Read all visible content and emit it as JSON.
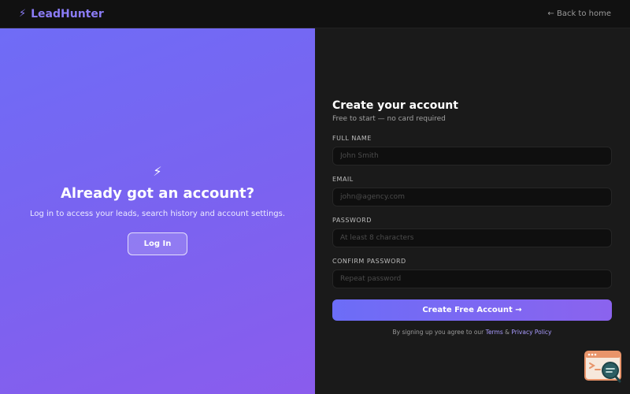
{
  "header": {
    "brand_icon": "⚡",
    "brand_name": "LeadHunter",
    "back_link": "← Back to home"
  },
  "left": {
    "icon": "⚡",
    "title": "Already got an account?",
    "text": "Log in to access your leads, search history and account settings.",
    "login_label": "Log In"
  },
  "form": {
    "title": "Create your account",
    "subtitle": "Free to start — no card required",
    "full_name": {
      "label": "FULL NAME",
      "placeholder": "John Smith",
      "value": ""
    },
    "email": {
      "label": "EMAIL",
      "placeholder": "john@agency.com",
      "value": ""
    },
    "password": {
      "label": "PASSWORD",
      "placeholder": "At least 8 characters",
      "value": ""
    },
    "confirm": {
      "label": "CONFIRM PASSWORD",
      "placeholder": "Repeat password",
      "value": ""
    },
    "submit_label": "Create Free Account →",
    "terms_prefix": "By signing up you agree to our",
    "terms_link": "Terms",
    "terms_and": "&",
    "privacy_link": "Privacy Policy"
  },
  "colors": {
    "accent": "#8b7cf6",
    "gradient_start": "#6f6cf6",
    "gradient_end": "#8a5ced",
    "dark_bg": "#1a1a1a",
    "widget_orange": "#e8946a",
    "widget_teal": "#2c5e63"
  },
  "widget": {
    "icon": "browser-search-icon"
  }
}
